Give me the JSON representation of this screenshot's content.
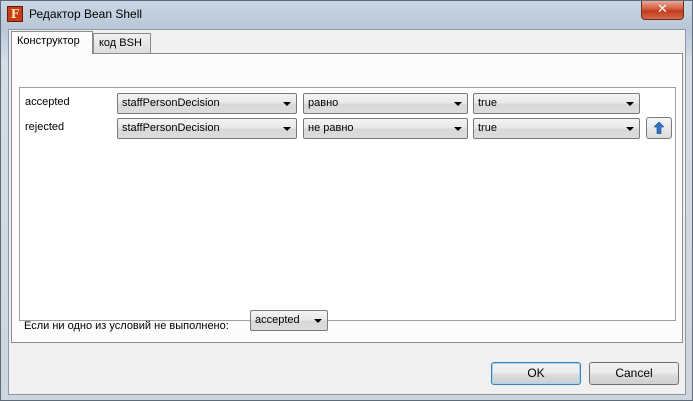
{
  "window": {
    "title": "Редактор Bean Shell",
    "close_label": "✕",
    "icon_letter": "F"
  },
  "tabs": [
    {
      "label": "Конструктор",
      "active": true
    },
    {
      "label": "код BSH",
      "active": false
    }
  ],
  "rules": [
    {
      "label": "accepted",
      "field": "staffPersonDecision",
      "operator": "равно",
      "value": "true"
    },
    {
      "label": "rejected",
      "field": "staffPersonDecision",
      "operator": "не равно",
      "value": "true"
    }
  ],
  "default_rule": {
    "label": "Если ни одно из условий не выполнено:",
    "value": "accepted"
  },
  "buttons": {
    "ok": "OK",
    "cancel": "Cancel"
  }
}
